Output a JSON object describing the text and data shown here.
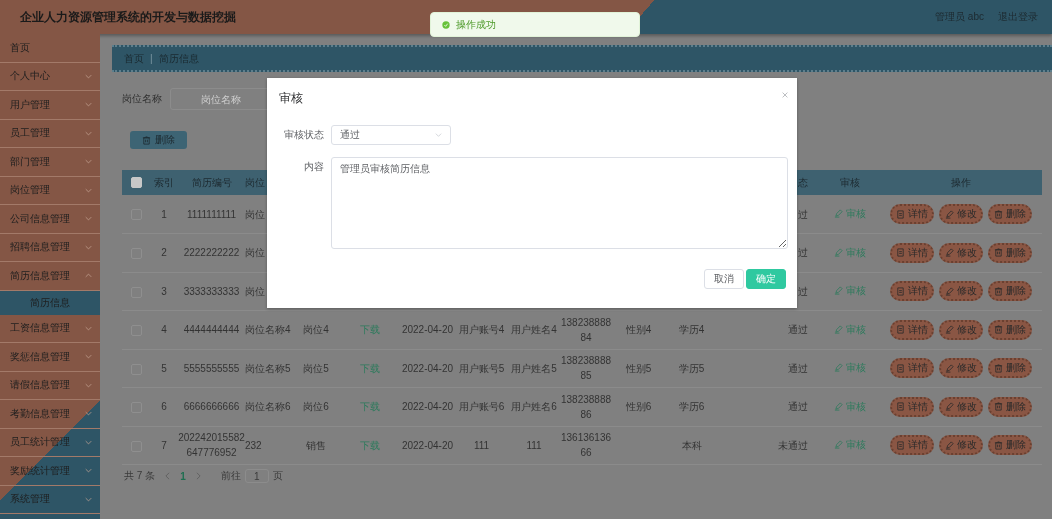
{
  "header": {
    "title": "企业人力资源管理系统的开发与数据挖掘",
    "user": "管理员 abc",
    "logout": "退出登录"
  },
  "toast": {
    "message": "操作成功"
  },
  "sidebar": {
    "items": [
      {
        "label": "首页",
        "kind": "link"
      },
      {
        "label": "个人中心",
        "kind": "submenu",
        "expanded": false
      },
      {
        "label": "用户管理",
        "kind": "submenu",
        "expanded": false
      },
      {
        "label": "员工管理",
        "kind": "submenu",
        "expanded": false
      },
      {
        "label": "部门管理",
        "kind": "submenu",
        "expanded": false
      },
      {
        "label": "岗位管理",
        "kind": "submenu",
        "expanded": false
      },
      {
        "label": "公司信息管理",
        "kind": "submenu",
        "expanded": false
      },
      {
        "label": "招聘信息管理",
        "kind": "submenu",
        "expanded": false
      },
      {
        "label": "简历信息管理",
        "kind": "submenu",
        "expanded": true,
        "children": [
          {
            "label": "简历信息",
            "selected": true
          }
        ]
      },
      {
        "label": "工资信息管理",
        "kind": "submenu",
        "expanded": false
      },
      {
        "label": "奖惩信息管理",
        "kind": "submenu",
        "expanded": false
      },
      {
        "label": "请假信息管理",
        "kind": "submenu",
        "expanded": false
      },
      {
        "label": "考勤信息管理",
        "kind": "submenu",
        "expanded": false
      },
      {
        "label": "员工统计管理",
        "kind": "submenu",
        "expanded": false
      },
      {
        "label": "奖励统计管理",
        "kind": "submenu",
        "expanded": false
      },
      {
        "label": "系统管理",
        "kind": "submenu",
        "expanded": false
      }
    ]
  },
  "breadcrumb": {
    "items": [
      "首页",
      "简历信息"
    ],
    "separator": "|"
  },
  "search": {
    "label": "岗位名称",
    "placeholder": "岗位名称"
  },
  "toolbar": {
    "delete_button": "删除"
  },
  "table": {
    "select_all": {
      "checked": false
    },
    "columns": {
      "index": "索引",
      "resume_no": "简历编号",
      "post_name": "岗位",
      "review_status": "态",
      "review": "审核",
      "actions": "操作"
    },
    "rows": [
      {
        "checked": false,
        "index": "1",
        "resume_no": "1111111111",
        "post_name": "岗位",
        "review_status": "过",
        "review": "审核",
        "actions": [
          {
            "kind": "detail",
            "label": "详情"
          },
          {
            "kind": "edit",
            "label": "修改"
          },
          {
            "kind": "delete",
            "label": "删除"
          }
        ]
      },
      {
        "checked": false,
        "index": "2",
        "resume_no": "2222222222",
        "post_name": "岗位",
        "review_status": "过",
        "review": "审核",
        "actions": [
          {
            "kind": "detail",
            "label": "详情"
          },
          {
            "kind": "edit",
            "label": "修改"
          },
          {
            "kind": "delete",
            "label": "删除"
          }
        ]
      },
      {
        "checked": false,
        "index": "3",
        "resume_no": "3333333333",
        "post_name": "岗位",
        "review_status": "过",
        "review": "审核",
        "actions": [
          {
            "kind": "detail",
            "label": "详情"
          },
          {
            "kind": "edit",
            "label": "修改"
          },
          {
            "kind": "delete",
            "label": "删除"
          }
        ]
      },
      {
        "checked": false,
        "index": "4",
        "resume_no": "4444444444",
        "post_name": "岗位名称4",
        "post": "岗位4",
        "attachment": "下载",
        "date": "2022-04-20",
        "account": "用户账号4",
        "name": "用户姓名4",
        "phone": "13823888884",
        "gender": "性别4",
        "education": "学历4",
        "review_status": "通过",
        "review": "审核",
        "actions": [
          {
            "kind": "detail",
            "label": "详情"
          },
          {
            "kind": "edit",
            "label": "修改"
          },
          {
            "kind": "delete",
            "label": "删除"
          }
        ]
      },
      {
        "checked": false,
        "index": "5",
        "resume_no": "5555555555",
        "post_name": "岗位名称5",
        "post": "岗位5",
        "attachment": "下载",
        "date": "2022-04-20",
        "account": "用户账号5",
        "name": "用户姓名5",
        "phone": "13823888885",
        "gender": "性别5",
        "education": "学历5",
        "review_status": "通过",
        "review": "审核",
        "actions": [
          {
            "kind": "detail",
            "label": "详情"
          },
          {
            "kind": "edit",
            "label": "修改"
          },
          {
            "kind": "delete",
            "label": "删除"
          }
        ]
      },
      {
        "checked": false,
        "index": "6",
        "resume_no": "6666666666",
        "post_name": "岗位名称6",
        "post": "岗位6",
        "attachment": "下载",
        "date": "2022-04-20",
        "account": "用户账号6",
        "name": "用户姓名6",
        "phone": "13823888886",
        "gender": "性别6",
        "education": "学历6",
        "review_status": "通过",
        "review": "审核",
        "actions": [
          {
            "kind": "detail",
            "label": "详情"
          },
          {
            "kind": "edit",
            "label": "修改"
          },
          {
            "kind": "delete",
            "label": "删除"
          }
        ]
      },
      {
        "checked": false,
        "index": "7",
        "resume_no": "202242015582647776952",
        "post_name": "232",
        "post": "销售",
        "attachment": "下载",
        "date": "2022-04-20",
        "account": "111",
        "name": "111",
        "phone": "13613613666",
        "education": "本科",
        "review_status": "未通过",
        "review": "审核",
        "actions": [
          {
            "kind": "detail",
            "label": "详情"
          },
          {
            "kind": "edit",
            "label": "修改"
          },
          {
            "kind": "delete",
            "label": "删除"
          }
        ]
      }
    ]
  },
  "pagination": {
    "total": "共 7 条",
    "pages": [
      {
        "label": "1",
        "selected": true
      }
    ],
    "goto_label": "前往",
    "goto_value": "1",
    "goto_suffix": "页"
  },
  "dialog": {
    "title": "审核",
    "fields": [
      {
        "kind": "select",
        "label": "审核状态",
        "value": "通过"
      },
      {
        "kind": "textarea",
        "label": "内容",
        "value": "管理员审核简历信息"
      }
    ],
    "buttons": [
      {
        "kind": "secondary",
        "label": "取消"
      },
      {
        "kind": "primary",
        "label": "确定"
      }
    ]
  }
}
